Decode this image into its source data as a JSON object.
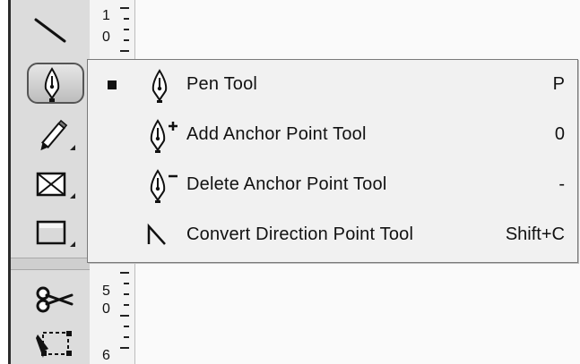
{
  "toolbar": {
    "tools": [
      {
        "name": "line-tool",
        "icon": "line-icon"
      },
      {
        "name": "pen-tool",
        "icon": "pen-icon",
        "selected": true
      },
      {
        "name": "pencil-tool",
        "icon": "pencil-icon"
      },
      {
        "name": "rectangle-frame-tool",
        "icon": "rectangle-frame-icon"
      },
      {
        "name": "rectangle-tool",
        "icon": "rectangle-icon"
      },
      {
        "name": "scissors-tool",
        "icon": "scissors-icon"
      },
      {
        "name": "free-transform-tool",
        "icon": "free-transform-icon"
      }
    ]
  },
  "ruler": {
    "labels": [
      {
        "top": "1",
        "bottom": "0"
      },
      {
        "top": "5",
        "bottom": "0"
      },
      {
        "top": "6",
        "bottom": ""
      }
    ]
  },
  "flyout_menu": {
    "items": [
      {
        "label": "Pen Tool",
        "shortcut": "P",
        "icon": "pen-icon",
        "checked": true
      },
      {
        "label": "Add Anchor Point Tool",
        "shortcut": "0",
        "icon": "add-anchor-point-icon",
        "checked": false
      },
      {
        "label": "Delete Anchor Point Tool",
        "shortcut": "-",
        "icon": "delete-anchor-point-icon",
        "checked": false
      },
      {
        "label": "Convert Direction Point Tool",
        "shortcut": "Shift+C",
        "icon": "convert-direction-point-icon",
        "checked": false
      }
    ]
  }
}
